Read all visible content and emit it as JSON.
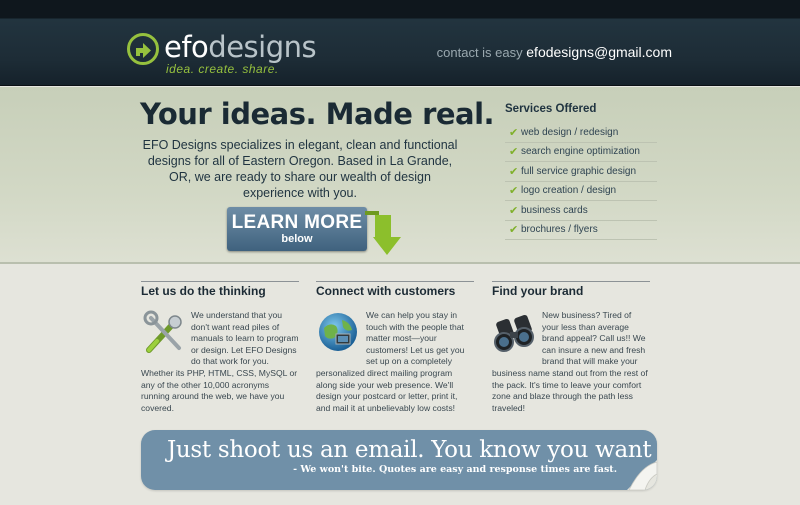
{
  "header": {
    "logo_efo": "efo",
    "logo_designs": "designs",
    "logo_tagline": "idea. create. share.",
    "contact_label": "contact is easy",
    "contact_email": "efodesigns@gmail.com"
  },
  "hero": {
    "headline": "Your ideas. Made real.",
    "intro": "EFO Designs specializes in elegant, clean and functional designs for all of Eastern Oregon. Based in La Grande, OR, we are ready to share our wealth of design experience with you.",
    "cta_main": "LEARN MORE",
    "cta_sub": "below"
  },
  "services": {
    "title": "Services Offered",
    "items": [
      "web design / redesign",
      "search engine optimization",
      "full service graphic design",
      "logo creation / design",
      "business cards",
      "brochures / flyers"
    ]
  },
  "columns": [
    {
      "title": "Let us do the thinking",
      "icon": "tools-icon",
      "body": "We understand that you don't want read piles of manuals to learn to program or design. Let EFO Designs do that work for you. Whether its PHP, HTML, CSS, MySQL or any of the other 10,000 acronyms running around the web, we have you covered."
    },
    {
      "title": "Connect with customers",
      "icon": "globe-network-icon",
      "body": "We can help you stay in touch with the people that matter most—your customers! Let us get you set up on a completely personalized direct mailing program along side your web presence. We'll design your postcard or letter, print it, and mail it at unbelievably low costs!"
    },
    {
      "title": "Find your brand",
      "icon": "binoculars-icon",
      "body": "New business? Tired of your less than average brand appeal? Call us!! We can insure a new and fresh brand that will make your business name stand out from the rest of the pack. It's time to leave your comfort zone and blaze through the path less traveled!"
    }
  ],
  "banner": {
    "title": "Just shoot us an email. You know you want to.",
    "subtitle": "- We won't bite. Quotes are easy and response times are fast."
  },
  "colors": {
    "accent_green": "#96c13e",
    "header_dark": "#1d2c36",
    "button_blue": "#4f728e",
    "banner_blue": "#7090a8"
  }
}
